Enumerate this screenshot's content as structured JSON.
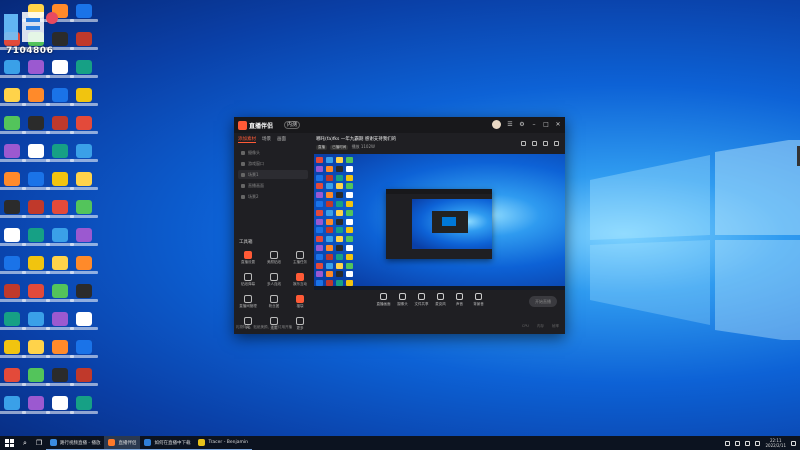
{
  "overlay": {
    "counter": "7104806"
  },
  "app": {
    "logo_text": "直播伴侣",
    "beta_label": "内测",
    "sidebar_tabs": [
      "添加素材",
      "场景",
      "画面"
    ],
    "sidebar_rows": [
      "摄像头",
      "游戏窗口",
      "场景1",
      "直播画面",
      "场景2"
    ],
    "tools_label": "工具箱",
    "tools": [
      "直播设置",
      "美颜贴纸",
      "主播任务",
      "贴纸弹幕",
      "多人连线",
      "娱乐互动",
      "直播间管理",
      "粉丝团",
      "福袋",
      "PK",
      "连麦",
      "更多"
    ],
    "sidebar_bottom": "礼物特效、贴纸美颜、闪光灯用开播",
    "main_title": "哪吒(fa)fks 一年九霸期 感谢支持我们的",
    "main_tags": [
      "直播",
      "已播时间"
    ],
    "main_sub": "播放 1102W",
    "controls": [
      "直播画面",
      "摄像头",
      "文件共享",
      "麦克风",
      "声音",
      "背景音"
    ],
    "start_label": "开始直播",
    "status": [
      "CPU",
      "内存",
      "帧率"
    ]
  },
  "taskbar": {
    "apps": [
      {
        "label": "路行视频直播 - 播放",
        "icon": "edge-icon",
        "color": "#3a8be0"
      },
      {
        "label": "直播伴侣",
        "icon": "app-icon",
        "color": "#ff7a2a"
      },
      {
        "label": "如何在直播中下载",
        "icon": "browser-icon",
        "color": "#2f7fd8"
      },
      {
        "label": "Tracer - Benjamin",
        "icon": "music-icon",
        "color": "#e8c21a"
      }
    ],
    "time": "22:11",
    "date": "2022/2/11"
  }
}
